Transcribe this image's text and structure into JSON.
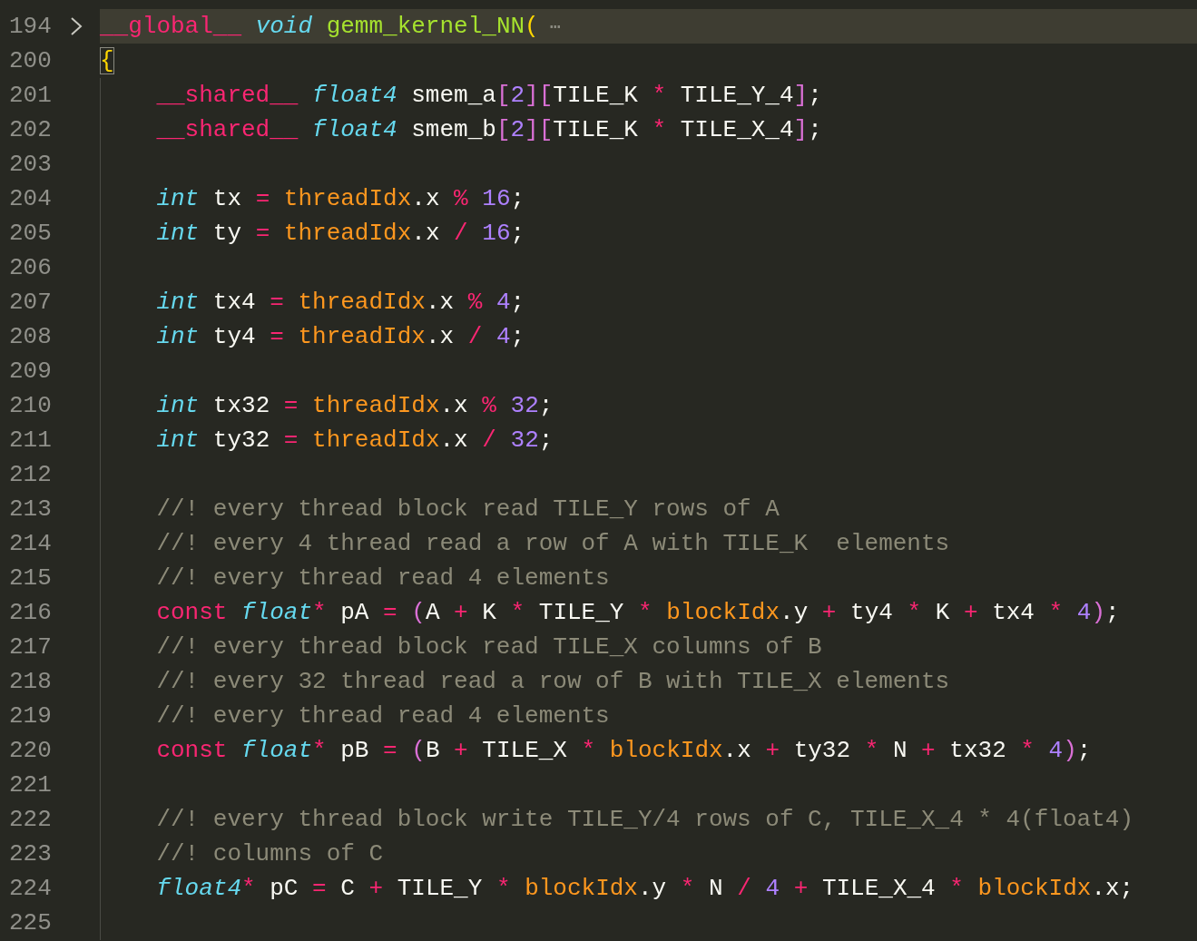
{
  "lines": [
    {
      "number": "194",
      "highlighted": true,
      "collapsed": true,
      "tokens": [
        {
          "kind": "kw",
          "text": "__global__"
        },
        {
          "kind": "type",
          "text": " void"
        },
        {
          "kind": "fn",
          "text": " gemm_kernel_NN"
        },
        {
          "kind": "br1",
          "text": "("
        },
        {
          "kind": "fold",
          "text": " ⋯"
        }
      ]
    },
    {
      "number": "200",
      "highlighted": false,
      "collapsed": false,
      "tokens": [
        {
          "kind": "br1",
          "text": "{",
          "matched": true
        }
      ],
      "children": [
        {
          "number": "201",
          "tokens": [
            {
              "kind": "kw",
              "text": "__shared__"
            },
            {
              "kind": "type",
              "text": " float4"
            },
            {
              "kind": "id",
              "text": " smem_a"
            },
            {
              "kind": "br2",
              "text": "["
            },
            {
              "kind": "num",
              "text": "2"
            },
            {
              "kind": "br2",
              "text": "]"
            },
            {
              "kind": "br2",
              "text": "["
            },
            {
              "kind": "id",
              "text": "TILE_K"
            },
            {
              "kind": "op",
              "text": " *"
            },
            {
              "kind": "id",
              "text": " TILE_Y_4"
            },
            {
              "kind": "br2",
              "text": "]"
            },
            {
              "kind": "id",
              "text": ";"
            }
          ]
        },
        {
          "number": "202",
          "tokens": [
            {
              "kind": "kw",
              "text": "__shared__"
            },
            {
              "kind": "type",
              "text": " float4"
            },
            {
              "kind": "id",
              "text": " smem_b"
            },
            {
              "kind": "br2",
              "text": "["
            },
            {
              "kind": "num",
              "text": "2"
            },
            {
              "kind": "br2",
              "text": "]"
            },
            {
              "kind": "br2",
              "text": "["
            },
            {
              "kind": "id",
              "text": "TILE_K"
            },
            {
              "kind": "op",
              "text": " *"
            },
            {
              "kind": "id",
              "text": " TILE_X_4"
            },
            {
              "kind": "br2",
              "text": "]"
            },
            {
              "kind": "id",
              "text": ";"
            }
          ]
        },
        {
          "number": "203"
        },
        {
          "number": "204",
          "tokens": [
            {
              "kind": "type",
              "text": "int"
            },
            {
              "kind": "id",
              "text": " tx"
            },
            {
              "kind": "op",
              "text": " ="
            },
            {
              "kind": "bi",
              "text": " threadIdx"
            },
            {
              "kind": "id",
              "text": ".x"
            },
            {
              "kind": "op",
              "text": " %"
            },
            {
              "kind": "num",
              "text": " 16"
            },
            {
              "kind": "id",
              "text": ";"
            }
          ]
        },
        {
          "number": "205",
          "tokens": [
            {
              "kind": "type",
              "text": "int"
            },
            {
              "kind": "id",
              "text": " ty"
            },
            {
              "kind": "op",
              "text": " ="
            },
            {
              "kind": "bi",
              "text": " threadIdx"
            },
            {
              "kind": "id",
              "text": ".x"
            },
            {
              "kind": "op",
              "text": " /"
            },
            {
              "kind": "num",
              "text": " 16"
            },
            {
              "kind": "id",
              "text": ";"
            }
          ]
        },
        {
          "number": "206"
        },
        {
          "number": "207",
          "tokens": [
            {
              "kind": "type",
              "text": "int"
            },
            {
              "kind": "id",
              "text": " tx4"
            },
            {
              "kind": "op",
              "text": " ="
            },
            {
              "kind": "bi",
              "text": " threadIdx"
            },
            {
              "kind": "id",
              "text": ".x"
            },
            {
              "kind": "op",
              "text": " %"
            },
            {
              "kind": "num",
              "text": " 4"
            },
            {
              "kind": "id",
              "text": ";"
            }
          ]
        },
        {
          "number": "208",
          "tokens": [
            {
              "kind": "type",
              "text": "int"
            },
            {
              "kind": "id",
              "text": " ty4"
            },
            {
              "kind": "op",
              "text": " ="
            },
            {
              "kind": "bi",
              "text": " threadIdx"
            },
            {
              "kind": "id",
              "text": ".x"
            },
            {
              "kind": "op",
              "text": " /"
            },
            {
              "kind": "num",
              "text": " 4"
            },
            {
              "kind": "id",
              "text": ";"
            }
          ]
        },
        {
          "number": "209"
        },
        {
          "number": "210",
          "tokens": [
            {
              "kind": "type",
              "text": "int"
            },
            {
              "kind": "id",
              "text": " tx32"
            },
            {
              "kind": "op",
              "text": " ="
            },
            {
              "kind": "bi",
              "text": " threadIdx"
            },
            {
              "kind": "id",
              "text": ".x"
            },
            {
              "kind": "op",
              "text": " %"
            },
            {
              "kind": "num",
              "text": " 32"
            },
            {
              "kind": "id",
              "text": ";"
            }
          ]
        },
        {
          "number": "211",
          "tokens": [
            {
              "kind": "type",
              "text": "int"
            },
            {
              "kind": "id",
              "text": " ty32"
            },
            {
              "kind": "op",
              "text": " ="
            },
            {
              "kind": "bi",
              "text": " threadIdx"
            },
            {
              "kind": "id",
              "text": ".x"
            },
            {
              "kind": "op",
              "text": " /"
            },
            {
              "kind": "num",
              "text": " 32"
            },
            {
              "kind": "id",
              "text": ";"
            }
          ]
        },
        {
          "number": "212"
        },
        {
          "number": "213",
          "tokens": [
            {
              "kind": "cm",
              "text": "//! every thread block read TILE_Y rows of A"
            }
          ]
        },
        {
          "number": "214",
          "tokens": [
            {
              "kind": "cm",
              "text": "//! every 4 thread read a row of A with TILE_K  elements"
            }
          ]
        },
        {
          "number": "215",
          "tokens": [
            {
              "kind": "cm",
              "text": "//! every thread read 4 elements"
            }
          ]
        },
        {
          "number": "216",
          "tokens": [
            {
              "kind": "kw",
              "text": "const"
            },
            {
              "kind": "type",
              "text": " float"
            },
            {
              "kind": "op",
              "text": "*"
            },
            {
              "kind": "id",
              "text": " pA"
            },
            {
              "kind": "op",
              "text": " ="
            },
            {
              "kind": "br2",
              "text": " ("
            },
            {
              "kind": "id",
              "text": "A"
            },
            {
              "kind": "op",
              "text": " +"
            },
            {
              "kind": "id",
              "text": " K"
            },
            {
              "kind": "op",
              "text": " *"
            },
            {
              "kind": "id",
              "text": " TILE_Y"
            },
            {
              "kind": "op",
              "text": " *"
            },
            {
              "kind": "bi",
              "text": " blockIdx"
            },
            {
              "kind": "id",
              "text": ".y"
            },
            {
              "kind": "op",
              "text": " +"
            },
            {
              "kind": "id",
              "text": " ty4"
            },
            {
              "kind": "op",
              "text": " *"
            },
            {
              "kind": "id",
              "text": " K"
            },
            {
              "kind": "op",
              "text": " +"
            },
            {
              "kind": "id",
              "text": " tx4"
            },
            {
              "kind": "op",
              "text": " *"
            },
            {
              "kind": "num",
              "text": " 4"
            },
            {
              "kind": "br2",
              "text": ")"
            },
            {
              "kind": "id",
              "text": ";"
            }
          ]
        },
        {
          "number": "217",
          "tokens": [
            {
              "kind": "cm",
              "text": "//! every thread block read TILE_X columns of B"
            }
          ]
        },
        {
          "number": "218",
          "tokens": [
            {
              "kind": "cm",
              "text": "//! every 32 thread read a row of B with TILE_X elements"
            }
          ]
        },
        {
          "number": "219",
          "tokens": [
            {
              "kind": "cm",
              "text": "//! every thread read 4 elements"
            }
          ]
        },
        {
          "number": "220",
          "tokens": [
            {
              "kind": "kw",
              "text": "const"
            },
            {
              "kind": "type",
              "text": " float"
            },
            {
              "kind": "op",
              "text": "*"
            },
            {
              "kind": "id",
              "text": " pB"
            },
            {
              "kind": "op",
              "text": " ="
            },
            {
              "kind": "br2",
              "text": " ("
            },
            {
              "kind": "id",
              "text": "B"
            },
            {
              "kind": "op",
              "text": " +"
            },
            {
              "kind": "id",
              "text": " TILE_X"
            },
            {
              "kind": "op",
              "text": " *"
            },
            {
              "kind": "bi",
              "text": " blockIdx"
            },
            {
              "kind": "id",
              "text": ".x"
            },
            {
              "kind": "op",
              "text": " +"
            },
            {
              "kind": "id",
              "text": " ty32"
            },
            {
              "kind": "op",
              "text": " *"
            },
            {
              "kind": "id",
              "text": " N"
            },
            {
              "kind": "op",
              "text": " +"
            },
            {
              "kind": "id",
              "text": " tx32"
            },
            {
              "kind": "op",
              "text": " *"
            },
            {
              "kind": "num",
              "text": " 4"
            },
            {
              "kind": "br2",
              "text": ")"
            },
            {
              "kind": "id",
              "text": ";"
            }
          ]
        },
        {
          "number": "221"
        },
        {
          "number": "222",
          "tokens": [
            {
              "kind": "cm",
              "text": "//! every thread block write TILE_Y/4 rows of C, TILE_X_4 * 4(float4)"
            }
          ]
        },
        {
          "number": "223",
          "tokens": [
            {
              "kind": "cm",
              "text": "//! columns of C"
            }
          ]
        },
        {
          "number": "224",
          "tokens": [
            {
              "kind": "type",
              "text": "float4"
            },
            {
              "kind": "op",
              "text": "*"
            },
            {
              "kind": "id",
              "text": " pC"
            },
            {
              "kind": "op",
              "text": " ="
            },
            {
              "kind": "id",
              "text": " C"
            },
            {
              "kind": "op",
              "text": " +"
            },
            {
              "kind": "id",
              "text": " TILE_Y"
            },
            {
              "kind": "op",
              "text": " *"
            },
            {
              "kind": "bi",
              "text": " blockIdx"
            },
            {
              "kind": "id",
              "text": ".y"
            },
            {
              "kind": "op",
              "text": " *"
            },
            {
              "kind": "id",
              "text": " N"
            },
            {
              "kind": "op",
              "text": " /"
            },
            {
              "kind": "num",
              "text": " 4"
            },
            {
              "kind": "op",
              "text": " +"
            },
            {
              "kind": "id",
              "text": " TILE_X_4"
            },
            {
              "kind": "op",
              "text": " *"
            },
            {
              "kind": "bi",
              "text": " blockIdx"
            },
            {
              "kind": "id",
              "text": ".x;"
            }
          ]
        },
        {
          "number": "225"
        }
      ]
    }
  ]
}
